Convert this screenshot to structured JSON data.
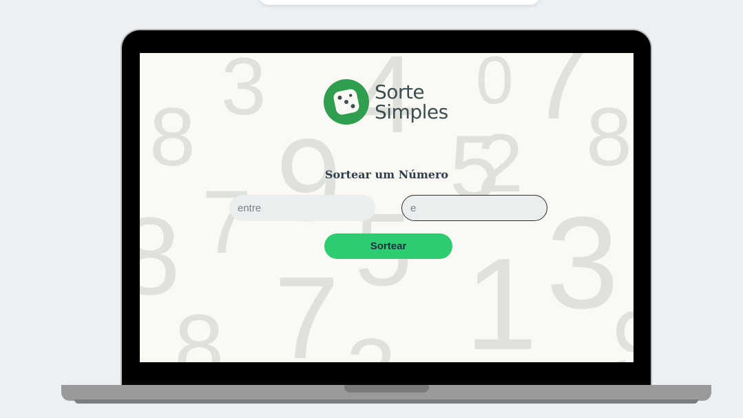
{
  "brand": {
    "line1": "Sorte",
    "line2": "Simples"
  },
  "page": {
    "title": "Sortear um Número"
  },
  "form": {
    "min_placeholder": "entre",
    "max_placeholder": "e",
    "min_value": "",
    "max_value": "",
    "submit_label": "Sortear"
  },
  "background_digits": [
    "3",
    "4",
    "0",
    "7",
    "8",
    "8",
    "9",
    "5",
    "2",
    "8",
    "7",
    "5",
    "3",
    "7",
    "1",
    "8",
    "9",
    "3",
    "9"
  ],
  "colors": {
    "accent": "#2ecc71",
    "logo_green": "#2f9e4e",
    "brand_text": "#3a4e4f",
    "screen_bg": "#fbf9f4",
    "page_bg": "#ecf0f3"
  }
}
